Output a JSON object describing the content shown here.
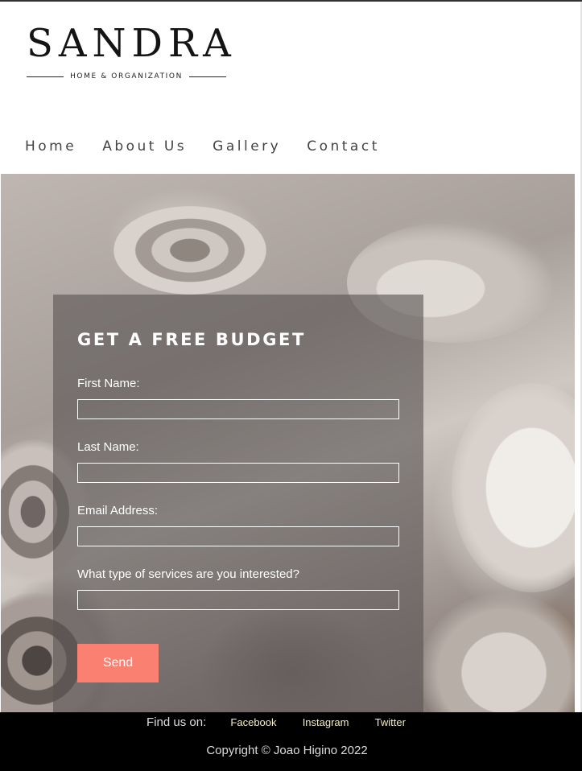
{
  "logo": {
    "name": "SANDRA",
    "tagline": "HOME & ORGANIZATION"
  },
  "nav": {
    "items": [
      "Home",
      "About Us",
      "Gallery",
      "Contact"
    ]
  },
  "form": {
    "title": "GET A FREE BUDGET",
    "fields": [
      {
        "label": "First Name:",
        "value": ""
      },
      {
        "label": "Last Name:",
        "value": ""
      },
      {
        "label": "Email Address:",
        "value": ""
      },
      {
        "label": "What type of services are you interested?",
        "value": ""
      }
    ],
    "submit_label": "Send"
  },
  "footer": {
    "find_us_label": "Find us on:",
    "social": [
      "Facebook",
      "Instagram",
      "Twitter"
    ],
    "copyright": "Copyright © Joao Higino 2022"
  },
  "colors": {
    "accent": "#fa8072",
    "footer_bg": "#000000",
    "social_link": "#f3edc0",
    "nav_text": "#444444"
  }
}
